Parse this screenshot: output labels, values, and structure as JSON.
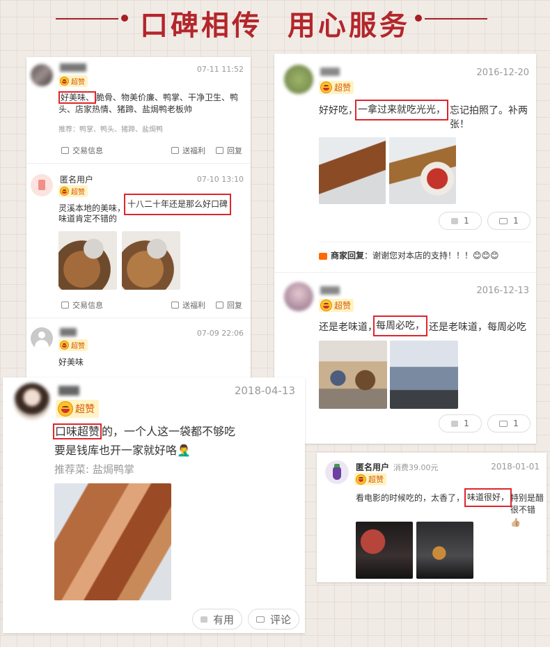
{
  "banner": {
    "title": "口碑相传  用心服务"
  },
  "card1": {
    "reviews": [
      {
        "date": "07-11 11:52",
        "badge": "超赞",
        "highlight": "好美味、",
        "text_rest": "脆骨、物美价廉、鸭掌、干净卫生、鸭头、店家热情、猪蹄、盐焗鸭老板帅",
        "recommend": "推荐：鸭掌、鸭头、猪蹄、盐焗鸭",
        "actions": {
          "trade": "交易信息",
          "gift": "送福利",
          "reply": "回复"
        }
      },
      {
        "name": "匿名用户",
        "date": "07-10 13:10",
        "badge": "超赞",
        "text_before": "灵溪本地的美味，",
        "highlight": "十八二十年还是那么好口碑",
        "text_after": "味道肯定不错的",
        "actions": {
          "trade": "交易信息",
          "gift": "送福利",
          "reply": "回复"
        }
      },
      {
        "date": "07-09 22:06",
        "badge": "超赞",
        "text": "好美味"
      }
    ]
  },
  "card2": {
    "reviews": [
      {
        "date": "2016-12-20",
        "badge": "超赞",
        "text_before": "好好吃，",
        "highlight": "一拿过来就吃光光，",
        "text_after": "忘记拍照了。补两张！",
        "likes": "1",
        "comments": "1",
        "merchant_label": "商家回复",
        "merchant_reply": "谢谢您对本店的支持！！！😊😊😊"
      },
      {
        "date": "2016-12-13",
        "badge": "超赞",
        "text_before": "还是老味道，",
        "highlight": "每周必吃，",
        "text_after": "还是老味道，每周必吃",
        "likes": "1",
        "comments": "1"
      }
    ]
  },
  "card3": {
    "date": "2018-04-13",
    "badge": "超赞",
    "highlight": "口味超赞",
    "text_after": "的，一个人这一袋都不够吃",
    "line2": "要是钱库也开一家就好咯🤦‍♂️",
    "recommend": "推荐菜: 盐焗鸭掌",
    "useful": "有用",
    "comment": "评论"
  },
  "card4": {
    "name": "匿名用户",
    "spend": "消费39.00元",
    "date": "2018-01-01",
    "badge": "超赞",
    "text_before": "看电影的时候吃的，太香了，",
    "highlight": "味道很好，",
    "text_after": "特别是醋很不错👍🏼"
  },
  "colors": {
    "accent": "#b3262b",
    "highlight_box": "#e0242a",
    "badge_bg": "#fff3c4",
    "badge_text": "#d85a00"
  }
}
